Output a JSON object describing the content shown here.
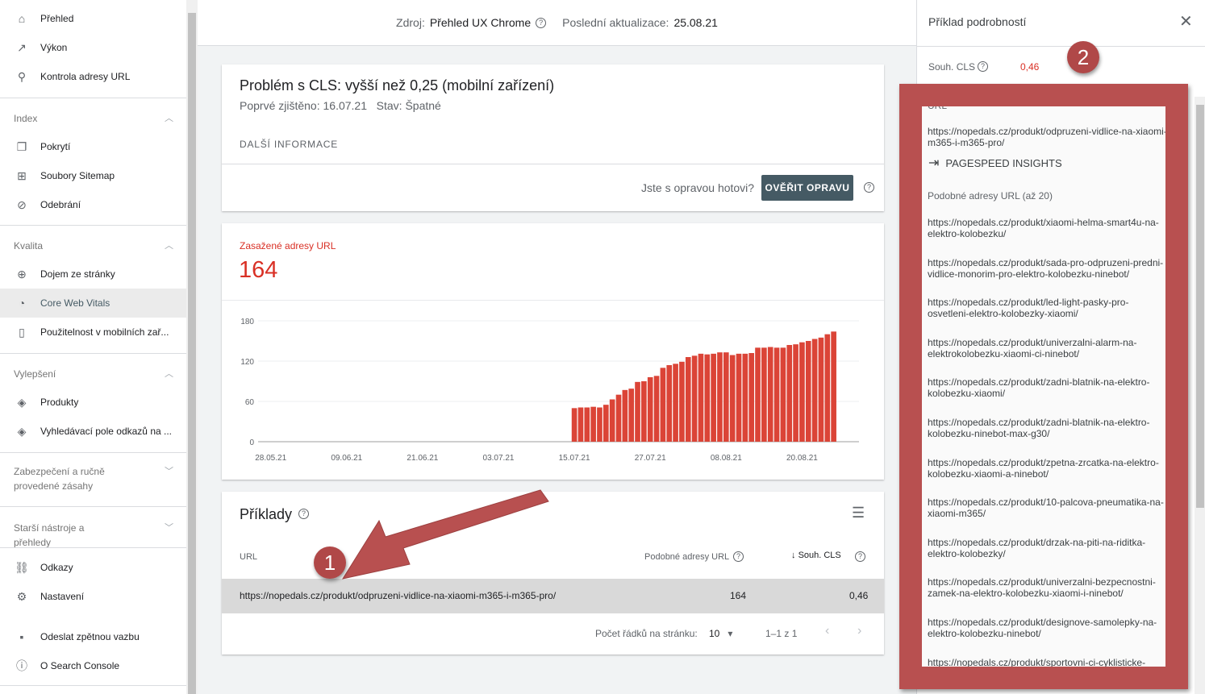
{
  "sidebar": {
    "top_items": [
      {
        "label": "Přehled",
        "icon": "home-icon"
      },
      {
        "label": "Výkon",
        "icon": "trending-up-icon"
      },
      {
        "label": "Kontrola adresy URL",
        "icon": "search-icon"
      }
    ],
    "sections": [
      {
        "title": "Index",
        "expanded": true,
        "items": [
          {
            "label": "Pokrytí",
            "icon": "copy-icon"
          },
          {
            "label": "Soubory Sitemap",
            "icon": "sitemap-icon"
          },
          {
            "label": "Odebrání",
            "icon": "eye-off-icon"
          }
        ]
      },
      {
        "title": "Kvalita",
        "expanded": true,
        "items": [
          {
            "label": "Dojem ze stránky",
            "icon": "plus-circle-icon"
          },
          {
            "label": "Core Web Vitals",
            "icon": "speedometer-icon",
            "active": true
          },
          {
            "label": "Použitelnost v mobilních zař...",
            "icon": "phone-icon"
          }
        ]
      },
      {
        "title": "Vylepšení",
        "expanded": true,
        "items": [
          {
            "label": "Produkty",
            "icon": "layers-icon"
          },
          {
            "label": "Vyhledávací pole odkazů na ...",
            "icon": "layers-icon"
          }
        ]
      },
      {
        "title": "Zabezpečení a ručně provedené zásahy",
        "expanded": false,
        "items": []
      },
      {
        "title": "Starší nástroje a přehledy",
        "expanded": false,
        "items": []
      }
    ],
    "bottom_items": [
      {
        "label": "Odkazy",
        "icon": "links-icon"
      },
      {
        "label": "Nastavení",
        "icon": "gear-icon"
      },
      {
        "label": "Odeslat zpětnou vazbu",
        "icon": "feedback-icon"
      },
      {
        "label": "O Search Console",
        "icon": "info-icon"
      }
    ]
  },
  "topbar": {
    "source_label": "Zdroj:",
    "source_value": "Přehled UX Chrome",
    "updated_label": "Poslední aktualizace:",
    "updated_value": "25.08.21"
  },
  "issue": {
    "title": "Problém s CLS: vyšší než 0,25 (mobilní zařízení)",
    "first_detected_label": "Poprvé zjištěno:",
    "first_detected": "16.07.21",
    "status_label": "Stav:",
    "status": "Špatné",
    "more_info": "DALŠÍ INFORMACE",
    "fix_question": "Jste s opravou hotovi?",
    "validate_button": "OVĚŘIT OPRAVU"
  },
  "affected": {
    "label": "Zasažené adresy URL",
    "count": "164",
    "color": "#d93025"
  },
  "chart_data": {
    "type": "bar",
    "title": "",
    "xlabel": "",
    "ylabel": "",
    "ylim": [
      0,
      180
    ],
    "yticks": [
      "0",
      "60",
      "120",
      "180"
    ],
    "xlim": [
      "26.05.21",
      "29.08.21"
    ],
    "xticks": [
      "28.05.21",
      "09.06.21",
      "21.06.21",
      "03.07.21",
      "15.07.21",
      "27.07.21",
      "08.08.21",
      "20.08.21"
    ],
    "grid": true,
    "color": "#db4437",
    "x_start": "15.07.21",
    "values": [
      50,
      51,
      51,
      52,
      51,
      55,
      63,
      70,
      77,
      79,
      89,
      90,
      96,
      98,
      110,
      114,
      116,
      119,
      126,
      128,
      131,
      130,
      131,
      133,
      133,
      129,
      131,
      131,
      132,
      140,
      140,
      141,
      140,
      140,
      144,
      145,
      148,
      150,
      153,
      155,
      160,
      164
    ]
  },
  "examples": {
    "title": "Příklady",
    "col_url": "URL",
    "col_similar": "Podobné adresy URL",
    "col_cls": "Souh. CLS",
    "rows": [
      {
        "url": "https://nopedals.cz/produkt/odpruzeni-vidlice-na-xiaomi-m365-i-m365-pro/",
        "similar": "164",
        "cls": "0,46"
      }
    ],
    "rows_per_page_label": "Počet řádků na stránku:",
    "rows_per_page": "10",
    "range": "1–1 z 1"
  },
  "panel": {
    "title": "Příklad podrobností",
    "cls_label": "Souh. CLS",
    "cls_value": "0,46",
    "url_label": "URL",
    "url": "https://nopedals.cz/produkt/odpruzeni-vidlice-na-xiaomi-m365-i-m365-pro/",
    "pagespeed": "PAGESPEED INSIGHTS",
    "similar_label": "Podobné adresy URL (až 20)",
    "similar": [
      "https://nopedals.cz/produkt/xiaomi-helma-smart4u-na-elektro-kolobezku/",
      "https://nopedals.cz/produkt/sada-pro-odpruzeni-predni-vidlice-monorim-pro-elektro-kolobezku-ninebot/",
      "https://nopedals.cz/produkt/led-light-pasky-pro-osvetleni-elektro-kolobezky-xiaomi/",
      "https://nopedals.cz/produkt/univerzalni-alarm-na-elektrokolobezku-xiaomi-ci-ninebot/",
      "https://nopedals.cz/produkt/zadni-blatnik-na-elektro-kolobezku-xiaomi/",
      "https://nopedals.cz/produkt/zadni-blatnik-na-elektro-kolobezku-ninebot-max-g30/",
      "https://nopedals.cz/produkt/zpetna-zrcatka-na-elektro-kolobezku-xiaomi-a-ninebot/",
      "https://nopedals.cz/produkt/10-palcova-pneumatika-na-xiaomi-m365/",
      "https://nopedals.cz/produkt/drzak-na-piti-na-riditka-elektro-kolobezky/",
      "https://nopedals.cz/produkt/univerzalni-bezpecnostni-zamek-na-elektro-kolobezku-xiaomi-i-ninebot/",
      "https://nopedals.cz/produkt/designove-samolepky-na-elektro-kolobezku-ninebot/",
      "https://nopedals.cz/produkt/sportovni-ci-cyklisticke-"
    ]
  },
  "annotations": {
    "badge1": "1",
    "badge2": "2",
    "color": "#b85050"
  }
}
